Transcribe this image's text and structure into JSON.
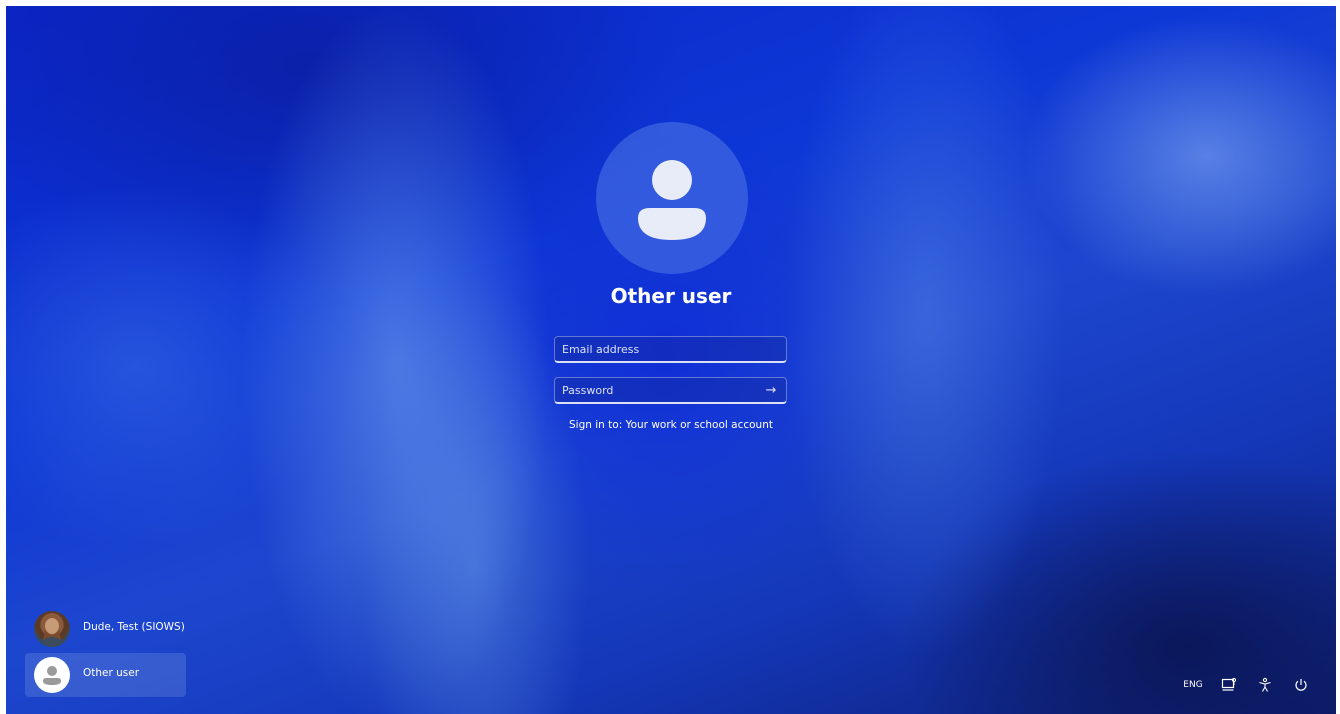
{
  "login": {
    "selected_user_name": "Other user",
    "email_placeholder": "Email address",
    "password_placeholder": "Password",
    "submit_arrow": "→",
    "signin_hint": "Sign in to: Your work or school account"
  },
  "user_list": [
    {
      "name": "Dude, Test (SIOWS)",
      "avatar": "photo",
      "selected": false
    },
    {
      "name": "Other user",
      "avatar": "generic-user-icon",
      "selected": true
    }
  ],
  "tray": {
    "language": "ENG",
    "network_icon": "network-icon",
    "accessibility_icon": "accessibility-icon",
    "power_icon": "power-icon"
  },
  "colors": {
    "wallpaper_base": "#0a2bd0",
    "avatar_glyph": "#e8ecf8"
  }
}
